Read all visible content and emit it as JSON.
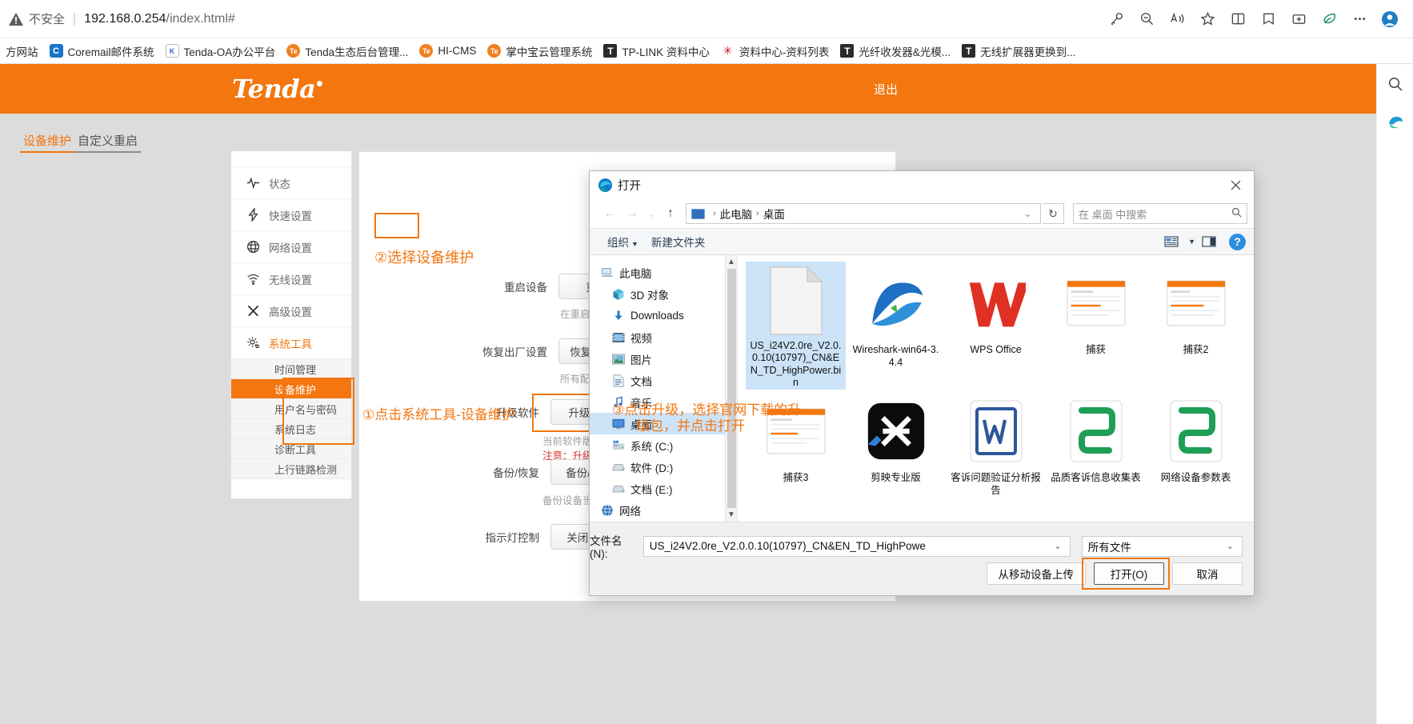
{
  "browser": {
    "security_label": "不安全",
    "url_host": "192.168.0.254",
    "url_path": "/index.html#",
    "icons": {
      "warning": "warning-triangle-icon",
      "key": "key-icon",
      "zoom_out": "zoom-out-icon",
      "read_aloud": "read-aloud-icon",
      "favorite": "star-icon",
      "split_screen": "split-screen-icon",
      "collections": "collections-icon",
      "browser_essentials": "browser-essentials-icon",
      "settings_more": "more-options-icon"
    },
    "bookmarks": [
      {
        "label": "方网站",
        "icon": "generic-site-icon",
        "icon_class": "none"
      },
      {
        "label": "Coremail邮件系统",
        "icon": "coremail-icon",
        "icon_class": "ico-blue",
        "glyph": "C"
      },
      {
        "label": "Tenda-OA办公平台",
        "icon": "kingsoft-icon",
        "icon_class": "ico-kis",
        "glyph": "K"
      },
      {
        "label": "Tenda生态后台管理...",
        "icon": "tenda-icon",
        "icon_class": "ico-orange",
        "glyph": "Te"
      },
      {
        "label": "HI-CMS",
        "icon": "tenda-icon",
        "icon_class": "ico-orange",
        "glyph": "Te"
      },
      {
        "label": "掌中宝云管理系统",
        "icon": "tenda-icon",
        "icon_class": "ico-orange",
        "glyph": "Te"
      },
      {
        "label": "TP-LINK 资料中心",
        "icon": "tplink-icon",
        "icon_class": "ico-t",
        "glyph": "T"
      },
      {
        "label": "资料中心-资料列表",
        "icon": "huawei-icon",
        "icon_class": "ico-hw",
        "glyph": "✳"
      },
      {
        "label": "光纤收发器&光模...",
        "icon": "tplink-icon",
        "icon_class": "ico-t",
        "glyph": "T"
      },
      {
        "label": "无线扩展器更换到...",
        "icon": "tplink-icon",
        "icon_class": "ico-t",
        "glyph": "T"
      }
    ]
  },
  "router": {
    "brand": "Tenda",
    "logout_label": "退出",
    "nav": [
      {
        "label": "状态",
        "icon": "pulse-icon",
        "glyph": "∿"
      },
      {
        "label": "快速设置",
        "icon": "lightning-icon",
        "glyph": "⚡"
      },
      {
        "label": "网络设置",
        "icon": "globe-icon",
        "glyph": "⊕"
      },
      {
        "label": "无线设置",
        "icon": "wifi-icon",
        "glyph": "≋"
      },
      {
        "label": "高级设置",
        "icon": "tools-icon",
        "glyph": "✂"
      },
      {
        "label": "系统工具",
        "icon": "gear-icon",
        "glyph": "⚙"
      }
    ],
    "subnav": [
      {
        "label": "时间管理",
        "selected": false
      },
      {
        "label": "设备维护",
        "selected": true
      },
      {
        "label": "用户名与密码",
        "selected": false
      },
      {
        "label": "系统日志",
        "selected": false
      },
      {
        "label": "诊断工具",
        "selected": false
      },
      {
        "label": "上行链路检测",
        "selected": false
      }
    ],
    "tabs": [
      {
        "label": "设备维护",
        "active": true
      },
      {
        "label": "自定义重启",
        "active": false
      }
    ],
    "rows": [
      {
        "label": "重启设备",
        "button": "重启",
        "hint": "在重启过程中，"
      },
      {
        "label": "恢复出厂设置",
        "button": "恢复出厂设",
        "hint": "所有配置会恢复"
      },
      {
        "label": "升级软件",
        "button": "升级",
        "hint": "当前软件版本：",
        "hint_red": "注意：升级过程"
      },
      {
        "label": "备份/恢复",
        "button": "备份/恢复",
        "hint": "备份设备当前的"
      },
      {
        "label": "指示灯控制",
        "button": "关闭所有指",
        "hint": ""
      }
    ],
    "annotations": [
      {
        "id": "anno-1",
        "text": "①点击系统工具-设备维护"
      },
      {
        "id": "anno-2",
        "text": "②选择设备维护"
      },
      {
        "id": "anno-3a",
        "text": "③点击升级，选择官网下载的升"
      },
      {
        "id": "anno-3b",
        "text": "级包，并点击打开"
      }
    ]
  },
  "filedialog": {
    "title": "打开",
    "title_icon": "edge-browser-icon",
    "close_icon": "close-icon",
    "nav": {
      "back_icon": "back-arrow-icon",
      "forward_icon": "forward-arrow-icon",
      "recent_icon": "recent-locations-icon",
      "up_icon": "up-arrow-icon",
      "breadcrumb": [
        "此电脑",
        "桌面"
      ],
      "breadcrumb_caret": "chevron-down-icon",
      "refresh_icon": "refresh-icon",
      "search_placeholder": "在 桌面 中搜索",
      "search_icon": "search-icon"
    },
    "toolbar": {
      "organize": "组织",
      "new_folder": "新建文件夹",
      "view_icon": "view-layout-icon",
      "view_caret": "chevron-down-icon",
      "preview_icon": "preview-pane-icon",
      "help_icon": "help-icon",
      "help_glyph": "?"
    },
    "tree": [
      {
        "label": "此电脑",
        "level": 0,
        "icon": "this-pc-icon",
        "glyph": "🖳",
        "selected": false
      },
      {
        "label": "3D 对象",
        "level": 1,
        "icon": "3d-objects-icon",
        "glyph": "◧",
        "selected": false
      },
      {
        "label": "Downloads",
        "level": 1,
        "icon": "downloads-icon",
        "glyph": "⬇",
        "selected": false
      },
      {
        "label": "视频",
        "level": 1,
        "icon": "videos-icon",
        "glyph": "▦",
        "selected": false
      },
      {
        "label": "图片",
        "level": 1,
        "icon": "pictures-icon",
        "glyph": "▤",
        "selected": false
      },
      {
        "label": "文档",
        "level": 1,
        "icon": "documents-icon",
        "glyph": "▤",
        "selected": false
      },
      {
        "label": "音乐",
        "level": 1,
        "icon": "music-icon",
        "glyph": "♪",
        "selected": false
      },
      {
        "label": "桌面",
        "level": 1,
        "icon": "desktop-icon",
        "glyph": "▭",
        "selected": true
      },
      {
        "label": "系统 (C:)",
        "level": 1,
        "icon": "windows-drive-icon",
        "glyph": "▰",
        "selected": false
      },
      {
        "label": "软件 (D:)",
        "level": 1,
        "icon": "drive-icon",
        "glyph": "▬",
        "selected": false
      },
      {
        "label": "文档 (E:)",
        "level": 1,
        "icon": "drive-icon",
        "glyph": "▬",
        "selected": false
      },
      {
        "label": "网络",
        "level": 0,
        "icon": "network-icon",
        "glyph": "🌐",
        "selected": false
      }
    ],
    "files": [
      {
        "name": "US_i24V2.0re_V2.0.0.10(10797)_CN&EN_TD_HighPower.bin",
        "icon": "generic-file-icon",
        "selected": true
      },
      {
        "name": "Wireshark-win64-3.4.4",
        "icon": "wireshark-icon",
        "selected": false
      },
      {
        "name": "WPS Office",
        "icon": "wps-office-icon",
        "selected": false
      },
      {
        "name": "捕获",
        "icon": "screenshot-icon",
        "selected": false
      },
      {
        "name": "捕获2",
        "icon": "screenshot-icon",
        "selected": false
      },
      {
        "name": "捕获3",
        "icon": "screenshot-icon",
        "selected": false
      },
      {
        "name": "剪映专业版",
        "icon": "jianying-icon",
        "selected": false
      },
      {
        "name": "客诉问题验证分析报告",
        "icon": "word-doc-icon",
        "selected": false
      },
      {
        "name": "品质客诉信息收集表",
        "icon": "excel-sheet-icon",
        "selected": false
      },
      {
        "name": "网络设备参数表",
        "icon": "excel-sheet-icon",
        "selected": false
      }
    ],
    "footer": {
      "filename_label": "文件名(N):",
      "filename_value": "US_i24V2.0re_V2.0.0.10(10797)_CN&EN_TD_HighPowe",
      "filetype_value": "所有文件",
      "caret_icon": "chevron-down-icon",
      "upload_button": "从移动设备上传",
      "open_button": "打开(O)",
      "cancel_button": "取消"
    }
  },
  "colors": {
    "brand_orange": "#f3760f",
    "selection_blue": "#cce3f7",
    "warn_red": "#e03030"
  }
}
